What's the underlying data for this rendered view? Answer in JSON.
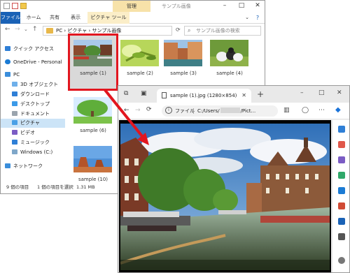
{
  "explorer": {
    "context_tab_header": "管理",
    "window_title": "サンプル画像",
    "tabs": [
      "ファイル",
      "ホーム",
      "共有",
      "表示",
      "ピクチャ ツール"
    ],
    "address": {
      "path": "PC  ›  ピクチャ  ›  サンプル画像",
      "search_placeholder": "サンプル画像の検索"
    },
    "nav": [
      {
        "label": "クイック アクセス",
        "icon": "star-icon"
      },
      {
        "label": "OneDrive - Personal",
        "icon": "cloud-icon"
      },
      {
        "label": "PC",
        "icon": "monitor-icon"
      },
      {
        "label": "3D オブジェクト",
        "icon": "cube-icon"
      },
      {
        "label": "ダウンロード",
        "icon": "download-icon"
      },
      {
        "label": "デスクトップ",
        "icon": "desktop-icon"
      },
      {
        "label": "ドキュメント",
        "icon": "document-icon"
      },
      {
        "label": "ピクチャ",
        "icon": "pictures-icon"
      },
      {
        "label": "ビデオ",
        "icon": "video-icon"
      },
      {
        "label": "ミュージック",
        "icon": "music-icon"
      },
      {
        "label": "Windows (C:)",
        "icon": "drive-icon"
      },
      {
        "label": "ネットワーク",
        "icon": "network-icon"
      }
    ],
    "files": [
      {
        "name": "sample (1)",
        "selected": true
      },
      {
        "name": "sample (2)",
        "selected": false
      },
      {
        "name": "sample (3)",
        "selected": false
      },
      {
        "name": "sample (4)",
        "selected": false
      },
      {
        "name": "sample (6)",
        "selected": false
      },
      {
        "name": "sample (10)",
        "selected": false
      }
    ],
    "status": {
      "count": "9 個の項目",
      "selection": "1 個の項目を選択",
      "size": "1.31 MB"
    }
  },
  "browser": {
    "tab_title": "sample (1).jpg (1280×854)",
    "url_scheme": "ファイル",
    "url_prefix": "C:/Users/",
    "url_suffix": "/Pict...",
    "accent_color": "#0a66c2"
  },
  "colors": {
    "selection_frame": "#e2161f",
    "arrow": "#e2161f"
  }
}
